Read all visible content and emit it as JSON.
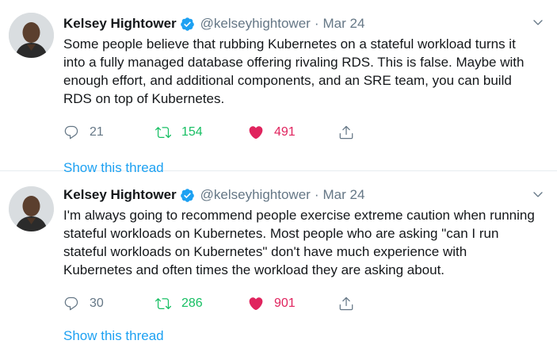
{
  "colors": {
    "link": "#1da1f2",
    "retweet": "#17bf63",
    "like": "#e0245e",
    "secondary": "#657786",
    "verified": "#1da1f2"
  },
  "tweets": [
    {
      "author": "Kelsey Hightower",
      "handle": "@kelseyhightower",
      "separator": "·",
      "date": "Mar 24",
      "text": "Some people believe that rubbing Kubernetes on a stateful workload turns it into a fully managed database offering rivaling RDS. This is false. Maybe with enough effort, and additional components, and an SRE team, you can build RDS on top of Kubernetes.",
      "replies": "21",
      "retweets": "154",
      "likes": "491",
      "show_thread": "Show this thread"
    },
    {
      "author": "Kelsey Hightower",
      "handle": "@kelseyhightower",
      "separator": "·",
      "date": "Mar 24",
      "text": "I'm always going to recommend people exercise extreme caution when running stateful workloads on Kubernetes. Most people who are asking \"can I run stateful workloads on Kubernetes\" don't have much experience with Kubernetes and often times the workload they are asking about.",
      "replies": "30",
      "retweets": "286",
      "likes": "901",
      "show_thread": "Show this thread"
    }
  ]
}
